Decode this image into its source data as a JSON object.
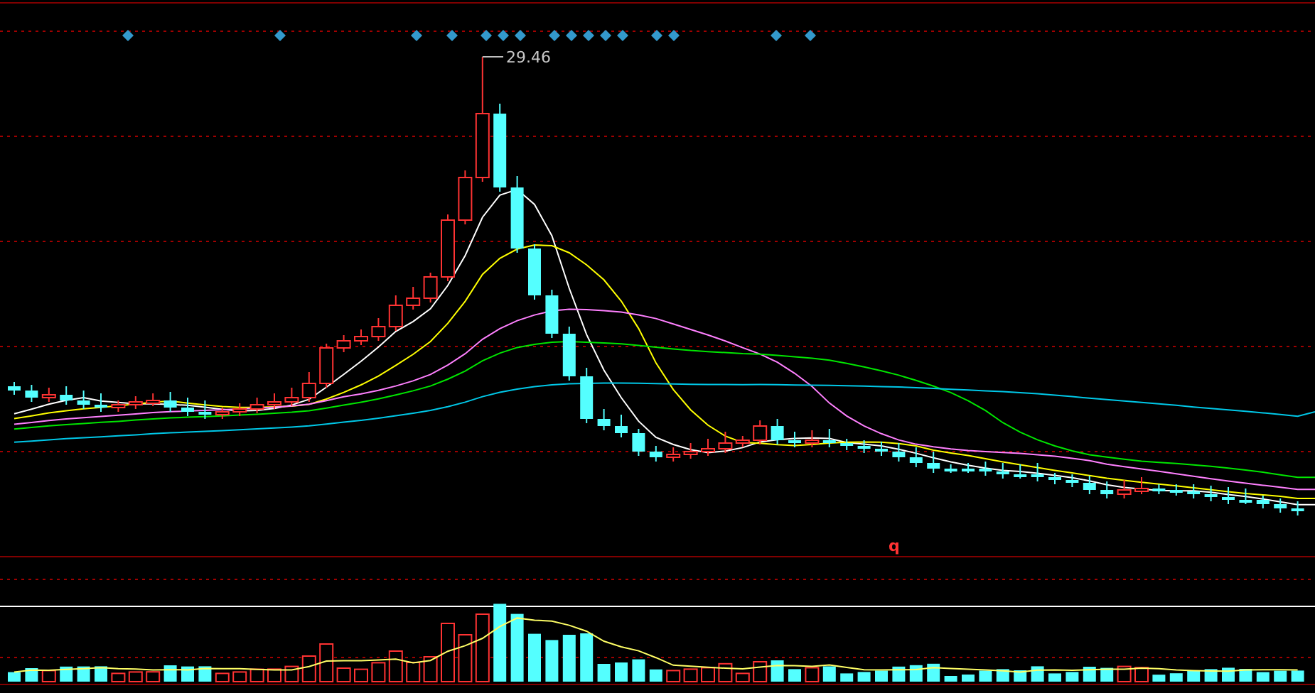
{
  "chart": {
    "high_label": "29.46",
    "marker": "q"
  }
}
